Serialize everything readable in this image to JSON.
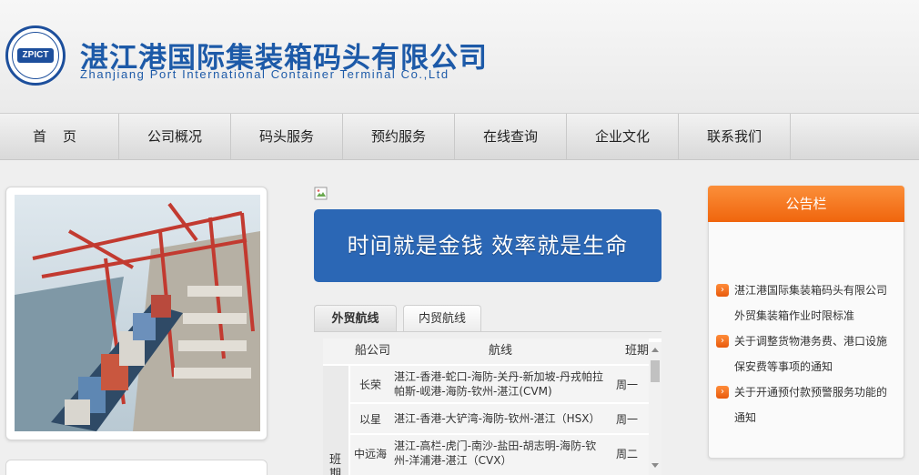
{
  "header": {
    "title_cn": "湛江港国际集装箱码头有限公司",
    "title_en": "Zhanjiang Port International Container Terminal Co.,Ltd",
    "logo_text": "ZPICT"
  },
  "nav": {
    "items": [
      {
        "label": "首页"
      },
      {
        "label": "公司概况"
      },
      {
        "label": "码头服务"
      },
      {
        "label": "预约服务"
      },
      {
        "label": "在线查询"
      },
      {
        "label": "企业文化"
      },
      {
        "label": "联系我们"
      }
    ]
  },
  "slogan": "时间就是金钱  效率就是生命",
  "tabs": [
    {
      "label": "外贸航线",
      "active": true
    },
    {
      "label": "内贸航线",
      "active": false
    }
  ],
  "routes": {
    "headers": {
      "company": "船公司",
      "route": "航线",
      "schedule": "班期"
    },
    "side_label": "班期",
    "rows": [
      {
        "company": "长荣",
        "route": "湛江-香港-蛇口-海防-关丹-新加坡-丹戎帕拉帕斯-岘港-海防-钦州-湛江(CVM)",
        "schedule": "周一"
      },
      {
        "company": "以星",
        "route": "湛江-香港-大铲湾-海防-钦州-湛江（HSX）",
        "schedule": "周一"
      },
      {
        "company": "中远海",
        "route": "湛江-高栏-虎门-南沙-盐田-胡志明-海防-钦州-洋浦港-湛江（CVX）",
        "schedule": "周二"
      }
    ]
  },
  "notice": {
    "title": "公告栏",
    "items": [
      {
        "text": "湛江港国际集装箱码头有限公司外贸集装箱作业时限标准"
      },
      {
        "text": "关于调整货物港务费、港口设施保安费等事项的通知"
      },
      {
        "text": "关于开通预付款预警服务功能的通知"
      }
    ]
  },
  "colors": {
    "brand_blue": "#1d5aa8",
    "slogan_bg": "#2b67b5",
    "notice_orange": "#f0650d"
  }
}
